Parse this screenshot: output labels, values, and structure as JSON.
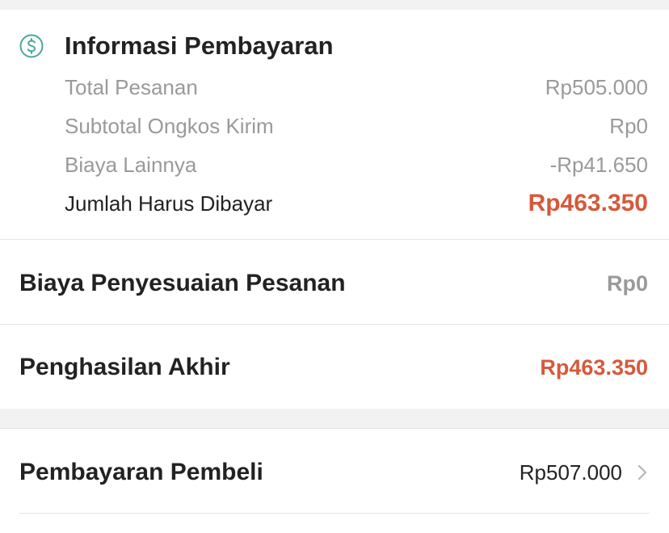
{
  "payment_info": {
    "icon": "dollar-circle-icon",
    "title": "Informasi Pembayaran",
    "rows": [
      {
        "label": "Total Pesanan",
        "value": "Rp505.000"
      },
      {
        "label": "Subtotal Ongkos Kirim",
        "value": "Rp0"
      },
      {
        "label": "Biaya Lainnya",
        "value": "-Rp41.650"
      }
    ],
    "total": {
      "label": "Jumlah Harus Dibayar",
      "value": "Rp463.350"
    }
  },
  "adjustment": {
    "label": "Biaya Penyesuaian Pesanan",
    "value": "Rp0"
  },
  "final_income": {
    "label": "Penghasilan Akhir",
    "value": "Rp463.350"
  },
  "buyer_payment": {
    "label": "Pembayaran Pembeli",
    "value": "Rp507.000",
    "icon": "chevron-right-icon"
  },
  "colors": {
    "accent": "#d6593b",
    "icon_green": "#4aa89a",
    "muted": "#9a9a9a",
    "text": "#222222",
    "background": "#f2f2f2"
  }
}
